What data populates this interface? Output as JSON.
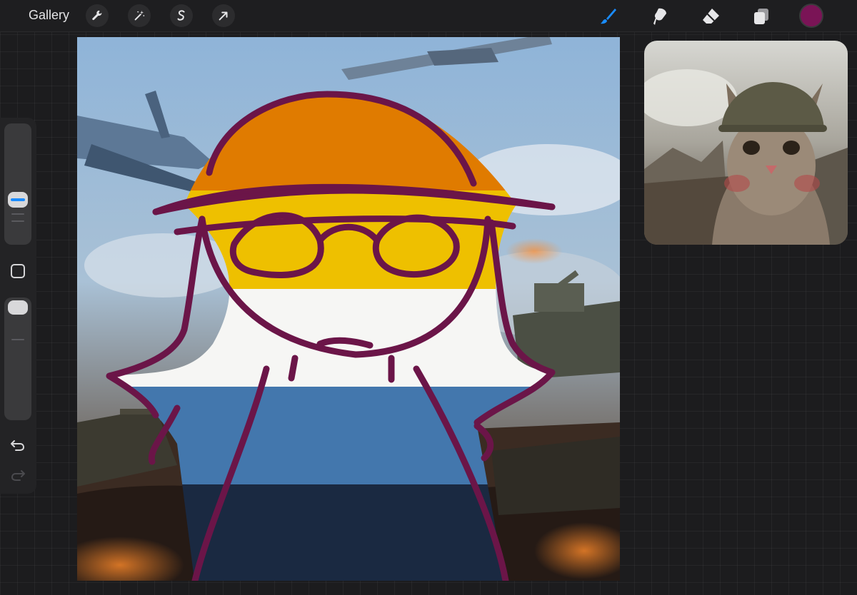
{
  "topbar": {
    "gallery_label": "Gallery",
    "action_tools": [
      "wrench-icon",
      "magic-wand-icon",
      "selection-icon",
      "transform-arrow-icon"
    ],
    "drawing_tools": [
      "brush-icon",
      "smudge-icon",
      "eraser-icon",
      "layers-icon"
    ],
    "active_tool": "brush-icon",
    "current_color": "#7a1456",
    "active_tool_color": "#1a8cff"
  },
  "sidebar": {
    "controls": [
      "brush-size-slider",
      "modify-button",
      "opacity-slider",
      "undo-button",
      "redo-button"
    ]
  },
  "canvas": {
    "subject": "drawing",
    "flag_colors": [
      "#e07b00",
      "#eec000",
      "#f6f6f4",
      "#4377ad",
      "#1a2941"
    ],
    "line_color": "#6b1548"
  },
  "reference_window": {
    "visible": true
  }
}
